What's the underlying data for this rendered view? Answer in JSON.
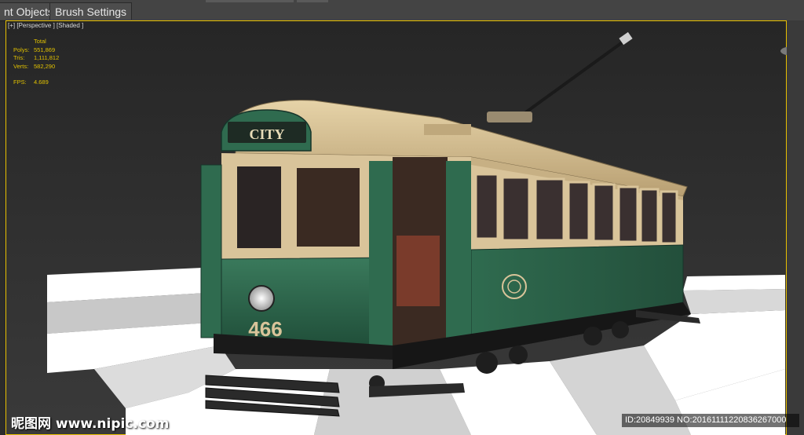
{
  "tabs": [
    {
      "label": "nt Objects"
    },
    {
      "label": "Brush Settings"
    }
  ],
  "viewport": {
    "label": "[+] [Perspective ] [Shaded ]",
    "stats": {
      "header": "Total",
      "rows": [
        {
          "key": "Polys:",
          "value": "551,869"
        },
        {
          "key": "Tris:",
          "value": "1,111,812"
        },
        {
          "key": "Verts:",
          "value": "582,290"
        },
        {
          "key": "FPS:",
          "value": "4.689"
        }
      ]
    }
  },
  "tram": {
    "destination": "CITY",
    "number": "466"
  },
  "colors": {
    "tram_green": "#2f6b4f",
    "tram_cream": "#d9c49a",
    "viewport_border": "#e8c000",
    "stats_text": "#e0c000"
  },
  "watermark": {
    "site": "昵图网 www.nipic.com",
    "id": "ID:20849939 NO:20161111220836267000"
  }
}
